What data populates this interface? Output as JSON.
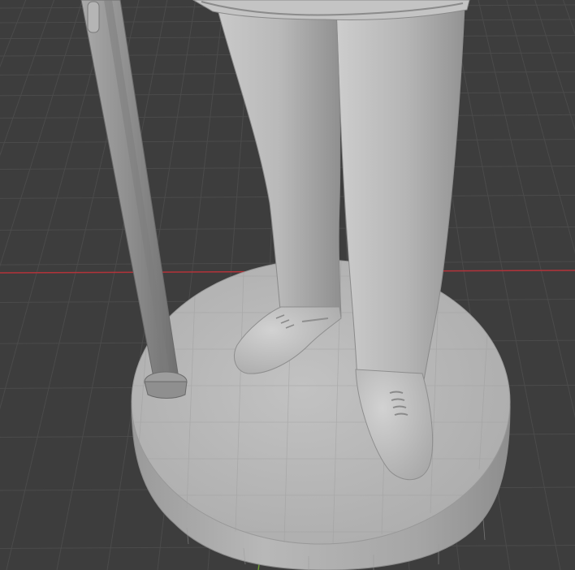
{
  "viewport": {
    "background_color": "#3d3d3d",
    "grid_color": "#4a4a4a",
    "x_axis_color": "#b3333a",
    "y_axis_color": "#6fa52e",
    "mesh_color": "#b4b4b4",
    "mesh_shadow_color": "#8c8c8c",
    "mesh_highlight_color": "#cfcfcf"
  },
  "scene": {
    "objects": [
      "statue-base",
      "walking-cane",
      "left-leg",
      "right-leg",
      "left-shoe",
      "right-shoe",
      "coat-hem"
    ]
  }
}
